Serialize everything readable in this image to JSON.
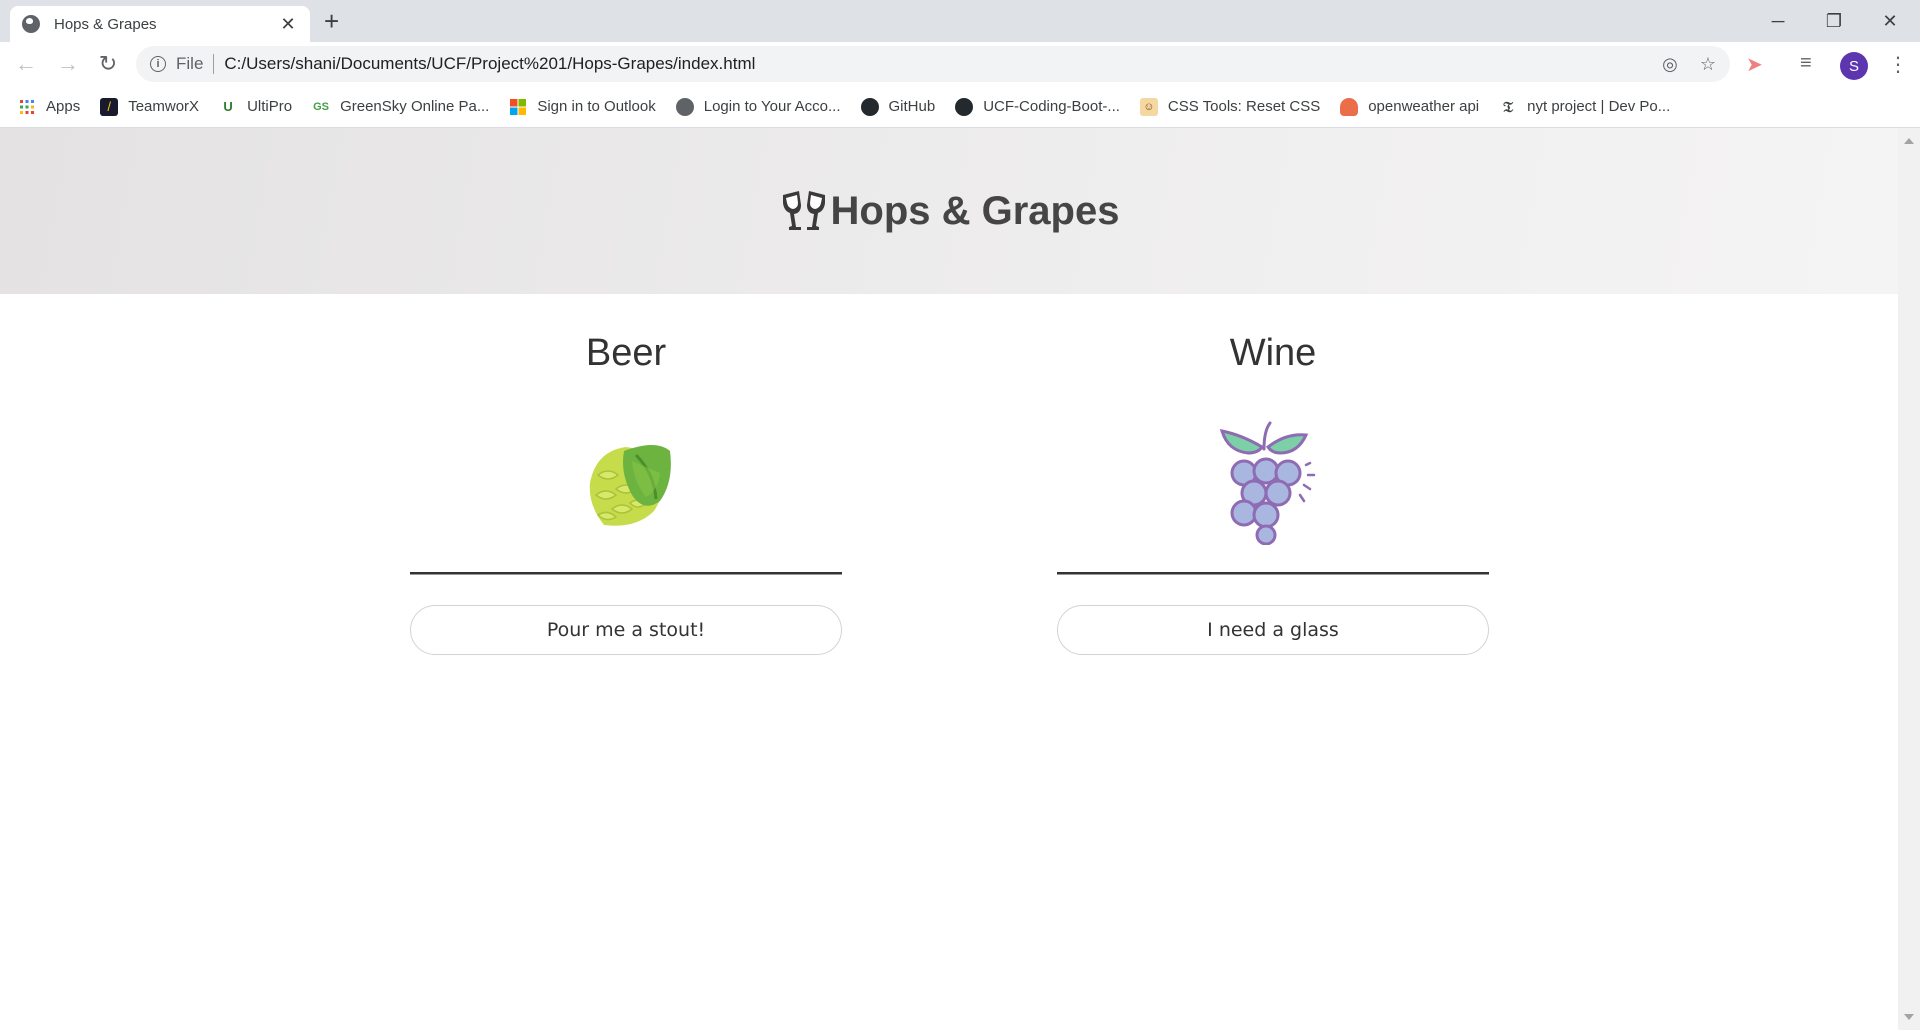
{
  "browser": {
    "tab_title": "Hops & Grapes",
    "address_scheme": "File",
    "address_url": "C:/Users/shani/Documents/UCF/Project%201/Hops-Grapes/index.html",
    "profile_initial": "S",
    "bookmarks": [
      {
        "label": "Apps",
        "icon": "apps-grid-icon"
      },
      {
        "label": "TeamworX",
        "icon": "teamworx-icon"
      },
      {
        "label": "UltiPro",
        "icon": "ultipro-icon"
      },
      {
        "label": "GreenSky Online Pa...",
        "icon": "greensky-icon"
      },
      {
        "label": "Sign in to Outlook",
        "icon": "microsoft-icon"
      },
      {
        "label": "Login to Your Acco...",
        "icon": "globe-icon"
      },
      {
        "label": "GitHub",
        "icon": "github-icon"
      },
      {
        "label": "UCF-Coding-Boot-...",
        "icon": "github-icon"
      },
      {
        "label": "CSS Tools: Reset CSS",
        "icon": "css-tools-icon"
      },
      {
        "label": "openweather api",
        "icon": "openweather-icon"
      },
      {
        "label": "nyt project | Dev Po...",
        "icon": "nyt-icon"
      }
    ]
  },
  "page": {
    "site_title": "Hops & Grapes",
    "beer": {
      "heading": "Beer",
      "button_label": "Pour me a stout!",
      "icon": "hop-cone-icon"
    },
    "wine": {
      "heading": "Wine",
      "button_label": "I need a glass",
      "icon": "grapes-icon"
    }
  },
  "colors": {
    "hero_bg": "#e8e6e6",
    "hop_green": "#8bc34a",
    "grape_purple": "#9fa8da",
    "grape_leaf": "#66bb9a"
  }
}
